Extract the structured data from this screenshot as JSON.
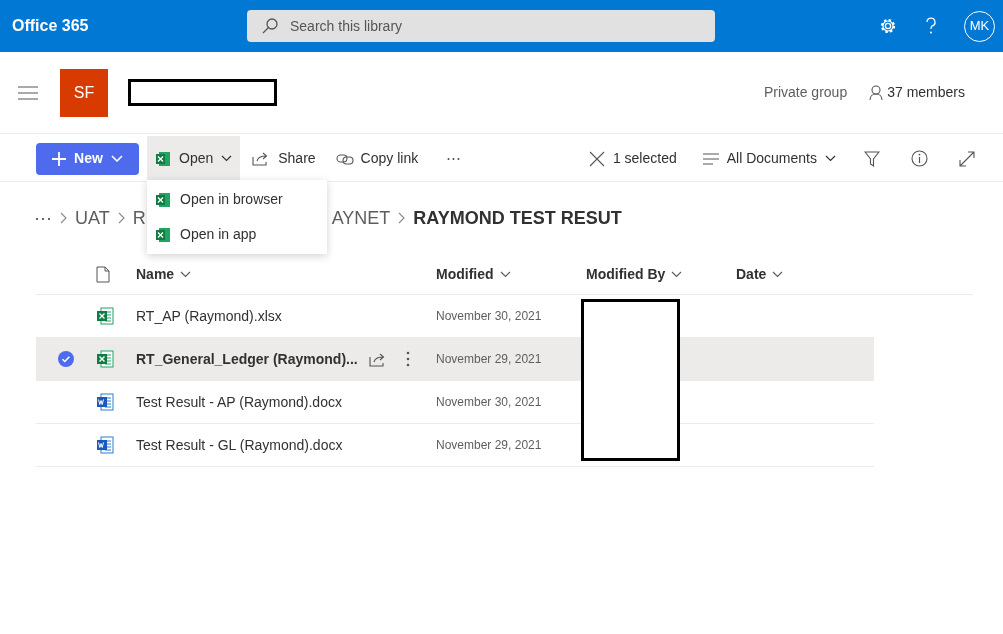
{
  "app_bar": {
    "title": "Office 365",
    "search": {
      "placeholder": "Search this library"
    },
    "avatar": "MK"
  },
  "site_header": {
    "logo": "SF",
    "privacy": "Private group",
    "members": "37 members"
  },
  "command_bar": {
    "new_button": "New",
    "open_button": "Open",
    "share": "Share",
    "copy_link": "Copy link",
    "more": "⋯",
    "selection": "1 selected",
    "view": "All Documents"
  },
  "open_menu": {
    "items": [
      {
        "label": "Open in browser"
      },
      {
        "label": "Open in app"
      }
    ]
  },
  "breadcrumb": {
    "overflow": "⋯",
    "items": [
      "UAT",
      "R",
      "AYNET",
      "RAYMOND TEST RESUT"
    ]
  },
  "table": {
    "columns": [
      "Name",
      "Modified",
      "Modified By",
      "Date"
    ],
    "rows": [
      {
        "kind": "excel",
        "name": "RT_AP (Raymond).xlsx",
        "modified": "November 30, 2021",
        "selected": false
      },
      {
        "kind": "excel",
        "name": "RT_General_Ledger (Raymond)...",
        "modified": "November 29, 2021",
        "selected": true
      },
      {
        "kind": "word",
        "name": "Test Result - AP (Raymond).docx",
        "modified": "November 30, 2021",
        "selected": false
      },
      {
        "kind": "word",
        "name": "Test Result - GL (Raymond).docx",
        "modified": "November 29, 2021",
        "selected": false
      }
    ]
  }
}
